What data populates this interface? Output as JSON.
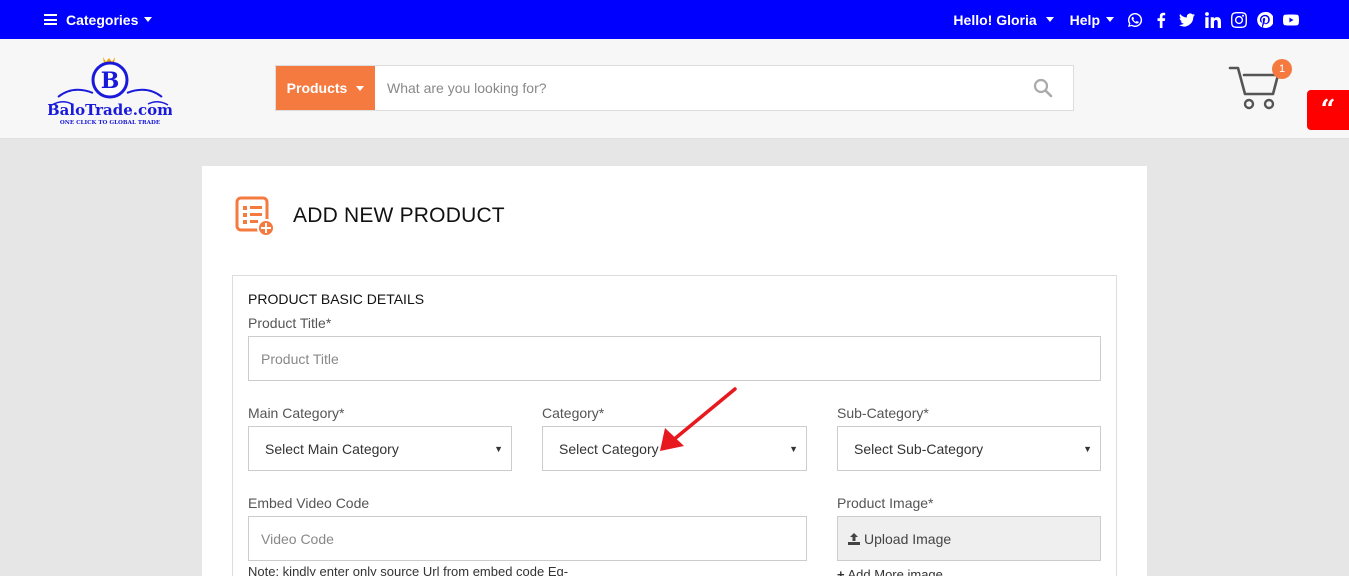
{
  "topbar": {
    "categories_label": "Categories",
    "greeting": "Hello! Gloria",
    "help_label": "Help",
    "social_icons": [
      "whatsapp-icon",
      "facebook-icon",
      "twitter-icon",
      "linkedin-icon",
      "instagram-icon",
      "pinterest-icon",
      "youtube-icon"
    ]
  },
  "header": {
    "logo_text": "BaloTrade.com",
    "logo_tagline": "ONE CLICK TO GLOBAL TRADE",
    "logo_letter": "B",
    "search_category": "Products",
    "search_placeholder": "What are you looking for?",
    "cart_count": "1",
    "quote_icon": "“"
  },
  "page": {
    "title": "ADD NEW PRODUCT",
    "section_title": "PRODUCT BASIC DETAILS",
    "product_title_label": "Product Title*",
    "product_title_placeholder": "Product Title",
    "main_category_label": "Main Category*",
    "main_category_value": "Select Main Category",
    "category_label": "Category*",
    "category_value": "Select Category",
    "sub_category_label": "Sub-Category*",
    "sub_category_value": "Select Sub-Category",
    "video_label": "Embed Video Code",
    "video_placeholder": "Video Code",
    "video_note": "Note: kindly enter only source Url from embed code Eg-",
    "image_label": "Product Image*",
    "upload_label": "Upload Image",
    "add_more_label": "Add More image"
  },
  "colors": {
    "topbar": "#0000ff",
    "accent": "#f47a40",
    "quote_button": "#ff0000",
    "annotation_arrow": "#e8191e"
  }
}
